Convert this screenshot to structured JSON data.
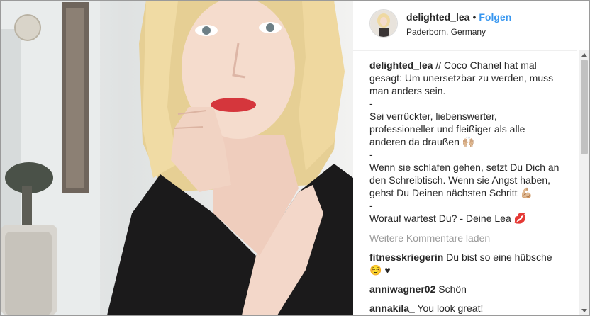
{
  "post": {
    "username": "delighted_lea",
    "separator": "•",
    "follow_label": "Folgen",
    "location": "Paderborn, Germany"
  },
  "caption": {
    "username": "delighted_lea",
    "lines": [
      " // Coco Chanel hat mal gesagt: Um unersetzbar zu werden, muss man anders sein.",
      "-",
      "Sei verrückter, liebenswerter, professioneller und fleißiger als alle anderen da draußen 🙌🏼",
      "-",
      "Wenn sie schlafen gehen, setzt Du Dich an den Schreibtisch. Wenn sie Angst haben, gehst Du Deinen nächsten Schritt 💪🏼",
      "-",
      "Worauf wartest Du? - Deine Lea 💋"
    ]
  },
  "load_more_label": "Weitere Kommentare laden",
  "comments": [
    {
      "username": "fitnesskriegerin",
      "text": "Du bist so eine hübsche ☺️ ♥"
    },
    {
      "username": "anniwagner02",
      "text": "Schön"
    },
    {
      "username": "annakila_",
      "text": "You look great!"
    }
  ],
  "icons": {
    "scroll_up": "scroll-up-arrow-icon",
    "scroll_down": "scroll-down-arrow-icon"
  },
  "colors": {
    "follow": "#3897f0",
    "muted": "#999999",
    "text": "#262626"
  }
}
